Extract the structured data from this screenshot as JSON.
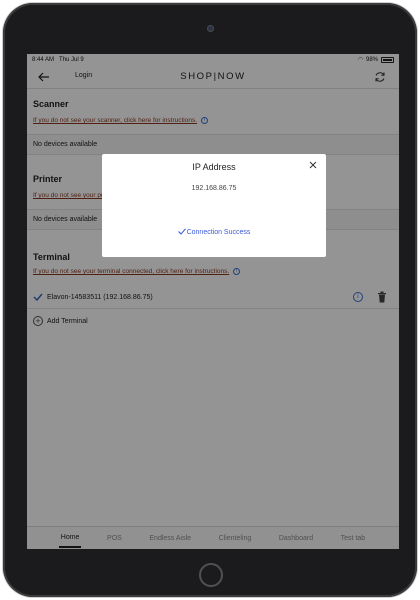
{
  "status_bar": {
    "time": "8:44 AM",
    "date": "Thu Jul 9",
    "battery": "98%"
  },
  "nav": {
    "back_label": "Login",
    "brand": "SHOP|NOW"
  },
  "scanner": {
    "title": "Scanner",
    "help_link": "If you do not see your scanner, click here for instructions.",
    "empty_text": "No devices available"
  },
  "printer": {
    "title": "Printer",
    "help_link": "If you do not see your printer, click here for instructions.",
    "empty_text": "No devices available"
  },
  "terminal": {
    "title": "Terminal",
    "help_link": "If you do not see your terminal connected, click here for instructions.",
    "device_label": "Elavon-14583511 (192.168.86.75)",
    "add_label": "Add Terminal"
  },
  "tabs": [
    {
      "label": "Home",
      "active": true
    },
    {
      "label": "POS"
    },
    {
      "label": "Endless Aisle"
    },
    {
      "label": "Clienteling"
    },
    {
      "label": "Dashboard"
    },
    {
      "label": "Test tab"
    }
  ],
  "modal": {
    "title": "IP Address",
    "ip": "192.168.86.75",
    "success": "Connection Success"
  },
  "colors": {
    "link": "#8a3a22",
    "accent": "#3b5bd6",
    "check": "#2f5fb8"
  }
}
